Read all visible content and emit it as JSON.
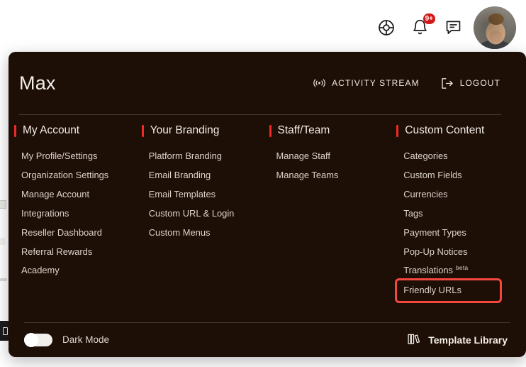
{
  "topbar": {
    "icons": [
      {
        "name": "help-lifebuoy-icon",
        "label": "Help"
      },
      {
        "name": "notifications-bell-icon",
        "label": "Notifications",
        "badge": "9+"
      },
      {
        "name": "messages-chat-icon",
        "label": "Messages"
      }
    ],
    "avatar_alt": "Max"
  },
  "panel": {
    "user_name": "Max",
    "actions": [
      {
        "name": "activity-stream",
        "label": "ACTIVITY STREAM",
        "icon": "broadcast-icon"
      },
      {
        "name": "logout",
        "label": "LOGOUT",
        "icon": "logout-icon"
      }
    ],
    "columns": [
      {
        "title": "My Account",
        "items": [
          {
            "label": "My Profile/Settings"
          },
          {
            "label": "Organization Settings"
          },
          {
            "label": "Manage Account"
          },
          {
            "label": "Integrations"
          },
          {
            "label": "Reseller Dashboard"
          },
          {
            "label": "Referral Rewards"
          },
          {
            "label": "Academy"
          }
        ]
      },
      {
        "title": "Your Branding",
        "items": [
          {
            "label": "Platform Branding"
          },
          {
            "label": "Email Branding"
          },
          {
            "label": "Email Templates"
          },
          {
            "label": "Custom URL & Login"
          },
          {
            "label": "Custom Menus"
          }
        ]
      },
      {
        "title": "Staff/Team",
        "items": [
          {
            "label": "Manage Staff"
          },
          {
            "label": "Manage Teams"
          }
        ]
      },
      {
        "title": "Custom Content",
        "items": [
          {
            "label": "Categories"
          },
          {
            "label": "Custom Fields"
          },
          {
            "label": "Currencies"
          },
          {
            "label": "Tags"
          },
          {
            "label": "Payment Types"
          },
          {
            "label": "Pop-Up Notices"
          },
          {
            "label": "Translations",
            "sup": "beta"
          },
          {
            "label": "Friendly URLs",
            "highlighted": true
          }
        ]
      }
    ],
    "footer": {
      "dark_mode_label": "Dark Mode",
      "dark_mode_on": false,
      "template_library_label": "Template Library",
      "template_library_icon": "books-library-icon"
    }
  },
  "background": {
    "bottom_text": " "
  },
  "colors": {
    "panel_bg": "#1d0e06",
    "accent_red": "#ee2b24",
    "highlight_red": "#f4483f",
    "badge_red": "#d51717",
    "text_primary": "#f2ece6",
    "text_secondary": "#dcd3cb",
    "divider": "#46372f"
  }
}
